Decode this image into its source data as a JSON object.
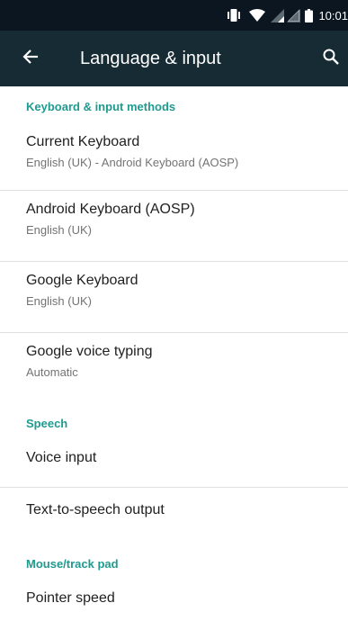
{
  "status_bar": {
    "time": "10:01",
    "icons": [
      "vibrate-icon",
      "wifi-icon",
      "signal-icon",
      "signal-icon",
      "battery-icon"
    ]
  },
  "app_bar": {
    "title": "Language & input",
    "back_icon": "arrow-back-icon",
    "search_icon": "search-icon"
  },
  "sections": {
    "keyboard": {
      "header": "Keyboard & input methods",
      "items": [
        {
          "title": "Current Keyboard",
          "subtitle": "English (UK) - Android Keyboard (AOSP)"
        },
        {
          "title": "Android Keyboard (AOSP)",
          "subtitle": "English (UK)"
        },
        {
          "title": "Google Keyboard",
          "subtitle": "English (UK)"
        },
        {
          "title": "Google voice typing",
          "subtitle": "Automatic"
        }
      ]
    },
    "speech": {
      "header": "Speech",
      "items": [
        {
          "title": "Voice input"
        },
        {
          "title": "Text-to-speech output"
        }
      ]
    },
    "mouse": {
      "header": "Mouse/track pad",
      "items": [
        {
          "title": "Pointer speed"
        }
      ]
    }
  },
  "colors": {
    "status_bar": "#0b1620",
    "app_bar": "#162b34",
    "accent": "#1f9a8f",
    "divider": "#e0e0e0"
  }
}
